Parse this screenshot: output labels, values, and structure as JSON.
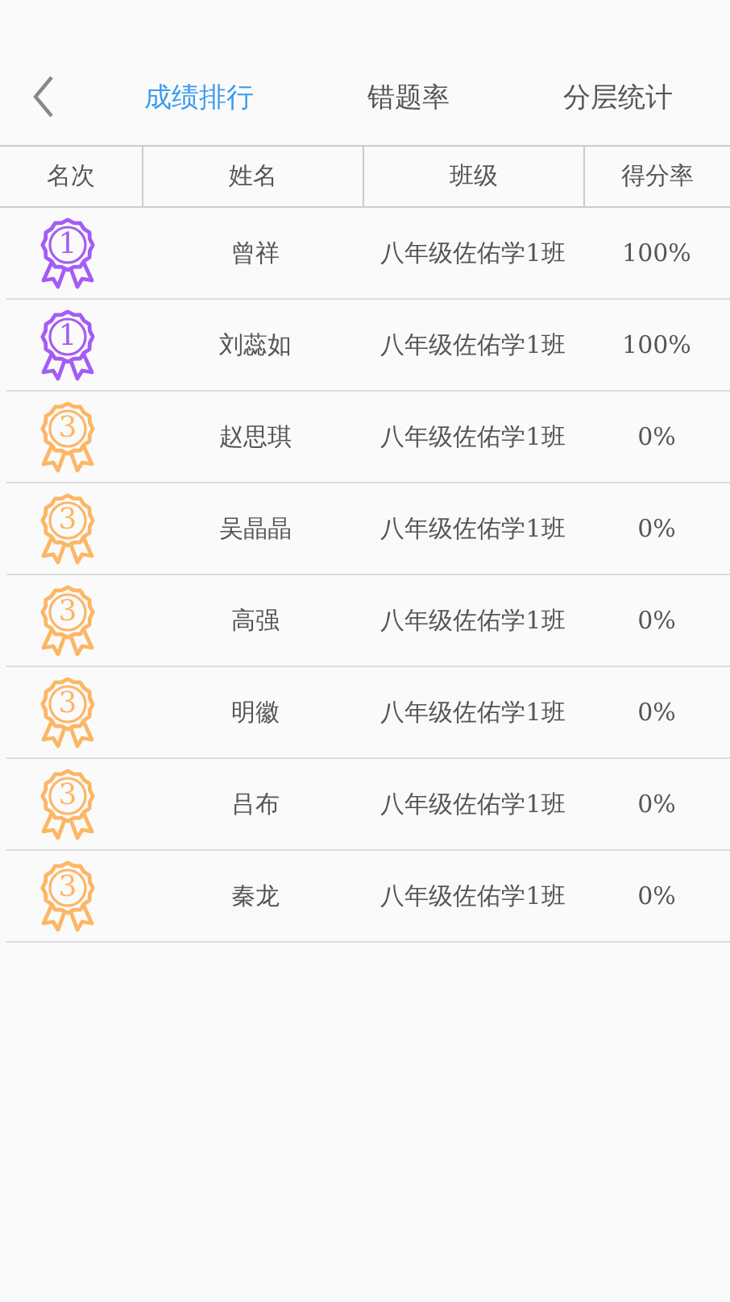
{
  "tabs": [
    {
      "label": "成绩排行",
      "selected": true
    },
    {
      "label": "错题率",
      "selected": false
    },
    {
      "label": "分层统计",
      "selected": false
    }
  ],
  "table": {
    "columns": [
      "名次",
      "姓名",
      "班级",
      "得分率"
    ],
    "rows": [
      {
        "rank": "1",
        "color": "#a55bf5",
        "name": "曾祥",
        "class": "八年级佐佑学1班",
        "score": "100%"
      },
      {
        "rank": "1",
        "color": "#a55bf5",
        "name": "刘蕊如",
        "class": "八年级佐佑学1班",
        "score": "100%"
      },
      {
        "rank": "3",
        "color": "#fdb664",
        "name": "赵思琪",
        "class": "八年级佐佑学1班",
        "score": "0%"
      },
      {
        "rank": "3",
        "color": "#fdb664",
        "name": "吴晶晶",
        "class": "八年级佐佑学1班",
        "score": "0%"
      },
      {
        "rank": "3",
        "color": "#fdb664",
        "name": "高强",
        "class": "八年级佐佑学1班",
        "score": "0%"
      },
      {
        "rank": "3",
        "color": "#fdb664",
        "name": "明徽",
        "class": "八年级佐佑学1班",
        "score": "0%"
      },
      {
        "rank": "3",
        "color": "#fdb664",
        "name": "吕布",
        "class": "八年级佐佑学1班",
        "score": "0%"
      },
      {
        "rank": "3",
        "color": "#fdb664",
        "name": "秦龙",
        "class": "八年级佐佑学1班",
        "score": "0%"
      }
    ]
  }
}
